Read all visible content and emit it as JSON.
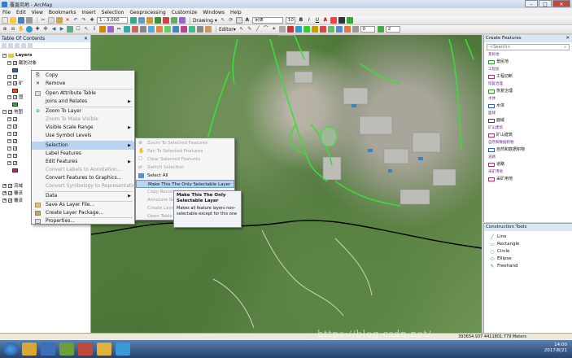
{
  "window": {
    "title": "覆盖岗地 - ArcMap",
    "minimize": "–",
    "maximize": "□",
    "close": "✕"
  },
  "menubar": [
    "File",
    "Edit",
    "View",
    "Bookmarks",
    "Insert",
    "Selection",
    "Geoprocessing",
    "Customize",
    "Windows",
    "Help"
  ],
  "toolbar": {
    "scale": "1 : 3,000",
    "drawing_label": "Drawing ▾",
    "font_name": "宋体",
    "font_size": "10",
    "bold": "B",
    "italic": "I",
    "underline": "U",
    "editor_label": "Editor▾",
    "line_width": "0",
    "zoom_value": "2"
  },
  "toc": {
    "title": "Table Of Contents",
    "root": "Layers",
    "rows": [
      "截防对象",
      "",
      "",
      "矿",
      "",
      "图",
      "",
      "地图",
      "",
      "",
      "",
      "",
      "",
      "",
      "",
      "流域",
      "覆该",
      "覆该"
    ]
  },
  "context_menu": {
    "items": [
      {
        "label": "Copy",
        "icon": "copy-icon",
        "disabled": false
      },
      {
        "label": "Remove",
        "icon": "remove-icon",
        "disabled": false
      },
      {
        "label": "Open Attribute Table",
        "icon": "table-icon",
        "disabled": false
      },
      {
        "label": "Joins and Relates",
        "icon": "",
        "disabled": false,
        "submenu": true
      },
      {
        "label": "Zoom To Layer",
        "icon": "zoom-icon",
        "disabled": false
      },
      {
        "label": "Zoom To Make Visible",
        "icon": "",
        "disabled": true
      },
      {
        "label": "Visible Scale Range",
        "icon": "",
        "disabled": false,
        "submenu": true
      },
      {
        "label": "Use Symbol Levels",
        "icon": "",
        "disabled": false
      },
      {
        "label": "Selection",
        "icon": "",
        "disabled": false,
        "submenu": true,
        "highlighted": true
      },
      {
        "label": "Label Features",
        "icon": "",
        "disabled": false
      },
      {
        "label": "Edit Features",
        "icon": "",
        "disabled": false,
        "submenu": true
      },
      {
        "label": "Convert Labels to Annotation...",
        "icon": "",
        "disabled": true
      },
      {
        "label": "Convert Features to Graphics...",
        "icon": "",
        "disabled": false
      },
      {
        "label": "Convert Symbology to Representation...",
        "icon": "",
        "disabled": true
      },
      {
        "label": "Data",
        "icon": "",
        "disabled": false,
        "submenu": true
      },
      {
        "label": "Save As Layer File...",
        "icon": "layer-file-icon",
        "disabled": false
      },
      {
        "label": "Create Layer Package...",
        "icon": "package-icon",
        "disabled": false
      },
      {
        "label": "Properties...",
        "icon": "properties-icon",
        "disabled": false
      }
    ]
  },
  "selection_submenu": {
    "items": [
      {
        "label": "Zoom To Selected Features",
        "disabled": true
      },
      {
        "label": "Pan To Selected Features",
        "disabled": true
      },
      {
        "label": "Clear Selected Features",
        "disabled": true
      },
      {
        "label": "Switch Selection",
        "disabled": true
      },
      {
        "label": "Select All",
        "disabled": false
      },
      {
        "label": "Make This The Only Selectable Layer",
        "disabled": false,
        "highlighted": true
      },
      {
        "label": "Copy Record",
        "disabled": true
      },
      {
        "label": "Annotate Se",
        "disabled": true
      },
      {
        "label": "Create Layer",
        "disabled": true
      },
      {
        "label": "Open Table",
        "disabled": true
      }
    ]
  },
  "tooltip": {
    "title": "Make This The Only Selectable Layer",
    "body": "Makes all feature layers non-selectable except for this one"
  },
  "create_features": {
    "title": "Create Features",
    "search_placeholder": "<Search>",
    "rows": [
      {
        "label": "景民地",
        "group": true
      },
      {
        "label": "景民地",
        "group": false,
        "color": "#2a9d2a"
      },
      {
        "label": "工程加",
        "group": true
      },
      {
        "label": "工程切断",
        "group": false,
        "color": "#b0306a"
      },
      {
        "label": "恢复治理",
        "group": true
      },
      {
        "label": "恢复治理",
        "group": false,
        "color": "#2a9d2a"
      },
      {
        "label": "水体",
        "group": true
      },
      {
        "label": "水体",
        "group": false,
        "color": "#2a60c8"
      },
      {
        "label": "面域",
        "group": true
      },
      {
        "label": "面域",
        "group": false,
        "color": "#444"
      },
      {
        "label": "矿山建筑",
        "group": true
      },
      {
        "label": "矿山建筑",
        "group": false,
        "color": "#b0306a"
      },
      {
        "label": "自然和数据积物",
        "group": true
      },
      {
        "label": "自然和数据积物",
        "group": false,
        "color": "#2a60c8"
      },
      {
        "label": "道路",
        "group": true
      },
      {
        "label": "道路",
        "group": false,
        "color": "#b0306a"
      },
      {
        "label": "采矿用地",
        "group": true
      },
      {
        "label": "采矿用地",
        "group": false,
        "color": "#b0306a"
      }
    ]
  },
  "construction_tools": {
    "title": "Construction Tools",
    "items": [
      "Line",
      "Rectangle",
      "Circle",
      "Ellipse",
      "Freehand"
    ]
  },
  "statusbar": {
    "coords": "393654.937  4411801.779 Meters",
    "watermark": "https://blog.csdn.net/"
  },
  "clock": {
    "time": "14:00",
    "date": "2017/8/21"
  },
  "colors": {
    "selection_highlight": "#b9d3f2",
    "road_green": "#3cdc3c",
    "boundary_black": "#000000"
  }
}
